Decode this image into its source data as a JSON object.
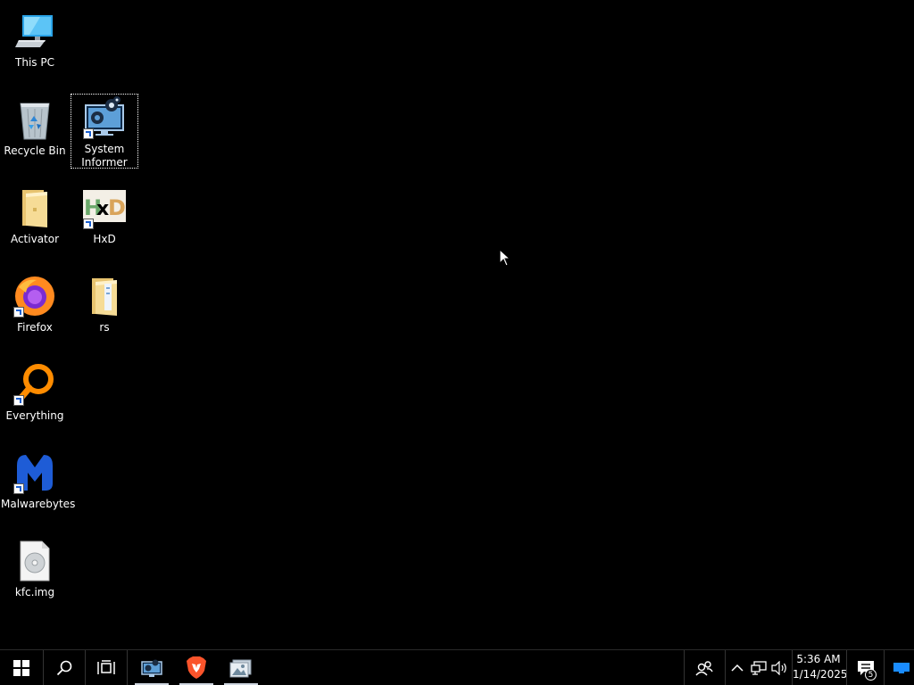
{
  "desktop_icons": {
    "this_pc": {
      "label": "This PC"
    },
    "recycle_bin": {
      "label": "Recycle Bin"
    },
    "system_informer": {
      "label": "System Informer"
    },
    "activator": {
      "label": "Activator"
    },
    "hxd": {
      "label": "HxD"
    },
    "firefox": {
      "label": "Firefox"
    },
    "rs": {
      "label": "rs"
    },
    "everything": {
      "label": "Everything"
    },
    "malwarebytes": {
      "label": "Malwarebytes"
    },
    "kfc_img": {
      "label": "kfc.img"
    }
  },
  "taskbar": {
    "clock_time": "5:36 AM",
    "clock_date": "1/14/2025",
    "notification_count": "5",
    "icons": [
      "windows-start-icon",
      "search-icon",
      "task-view-icon",
      "system-informer-icon",
      "brave-browser-icon",
      "pictures-app-icon",
      "people-icon",
      "chevron-up-icon",
      "network-icon",
      "volume-icon",
      "action-center-icon",
      "show-desktop-icon"
    ]
  },
  "colors": {
    "background": "#000000",
    "taskbar": "#000000",
    "accent": "#1a8cff"
  }
}
